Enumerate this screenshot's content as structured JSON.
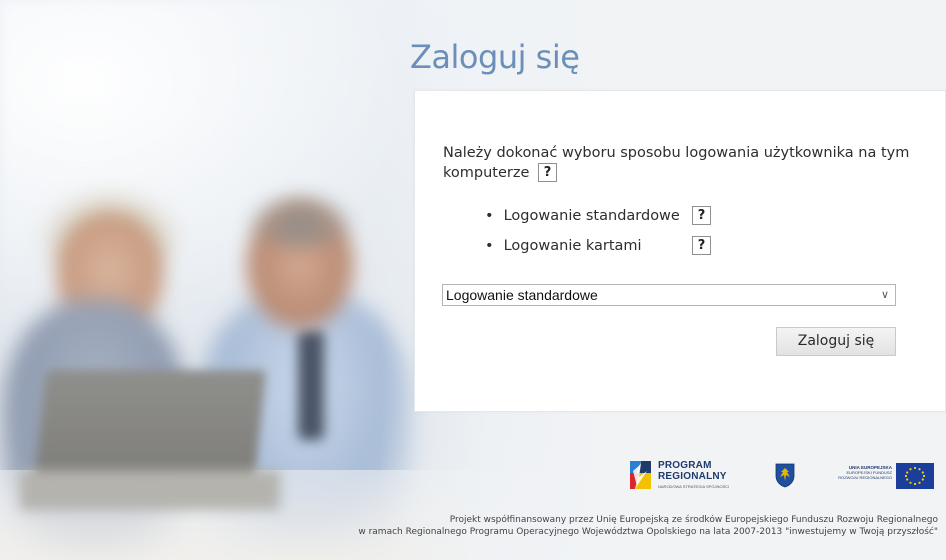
{
  "page": {
    "title": "Zaloguj się"
  },
  "panel": {
    "instruction": "Należy dokonać wyboru sposobu logowania użytkownika na tym komputerze",
    "help_label": "?",
    "options": [
      {
        "bullet": "•",
        "label": "Logowanie standardowe"
      },
      {
        "bullet": "•",
        "label": "Logowanie kartami"
      }
    ],
    "select": {
      "value": "Logowanie standardowe",
      "chevron": "∨"
    },
    "submit_label": "Zaloguj się"
  },
  "logos": {
    "program": {
      "line1": "PROGRAM",
      "line2": "REGIONALNY",
      "line3": "NARODOWA STRATEGIA SPÓJNOŚCI"
    },
    "eu": {
      "line1": "UNIA EUROPEJSKA",
      "line2": "EUROPEJSKI FUNDUSZ",
      "line3": "ROZWOJU REGIONALNEGO"
    },
    "colors": {
      "eu_blue": "#1a3e9a",
      "eu_star": "#ffd200",
      "program_navy": "#1f3b6e",
      "program_red": "#d8282f",
      "program_blue": "#2b7fd3"
    }
  },
  "footer": {
    "line1": "Projekt współfinansowany przez Unię Europejską ze środków Europejskiego Funduszu Rozwoju Regionalnego",
    "line2": "w ramach Regionalnego Programu Operacyjnego Województwa Opolskiego na lata 2007-2013 \"inwestujemy w Twoją przyszłość\""
  },
  "theme": {
    "title_color": "#6b8fb8",
    "panel_bg": "#ffffff"
  }
}
